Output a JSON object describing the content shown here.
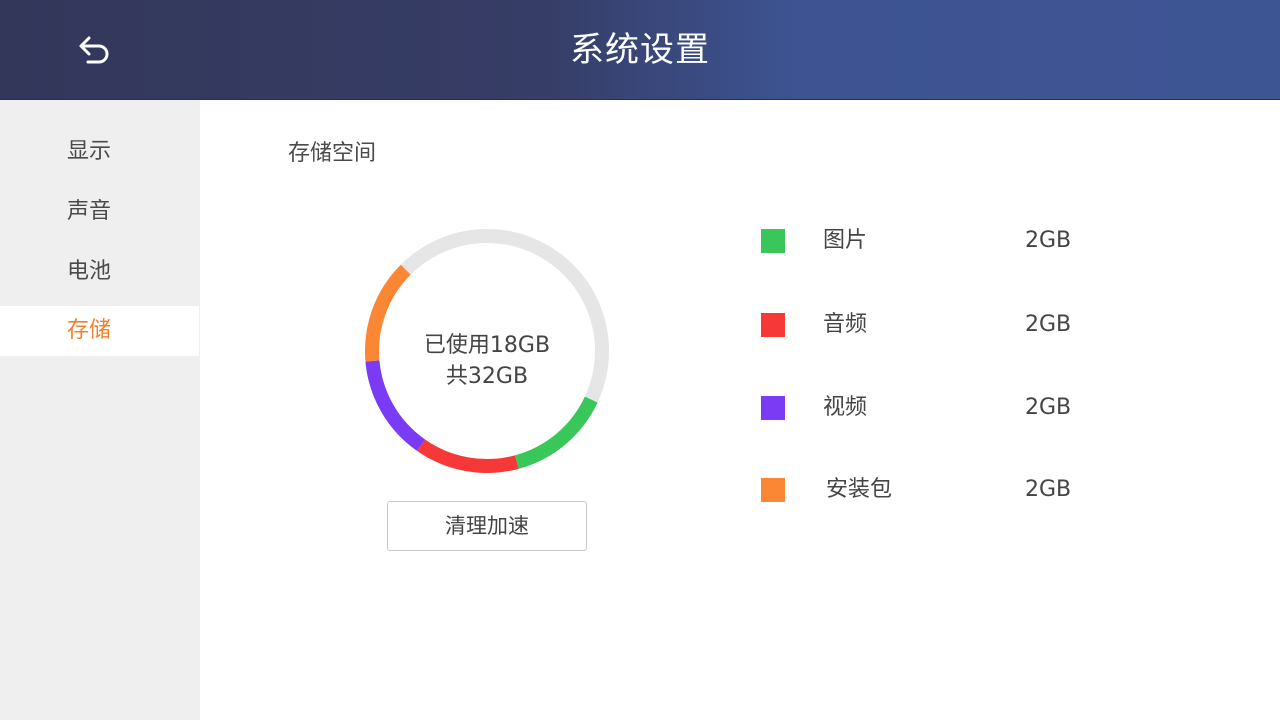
{
  "header": {
    "title": "系统设置",
    "back_icon": "back-arrow-icon"
  },
  "sidebar": {
    "items": [
      {
        "label": "显示",
        "active": false
      },
      {
        "label": "声音",
        "active": false
      },
      {
        "label": "电池",
        "active": false
      },
      {
        "label": "存储",
        "active": true
      }
    ]
  },
  "storage": {
    "section_title": "存储空间",
    "used_text": "已使用18GB",
    "total_text": "共32GB",
    "clean_button": "清理加速",
    "track_color": "#e6e6e6",
    "categories": [
      {
        "label": "图片",
        "value": "2GB",
        "color": "#39c75a"
      },
      {
        "label": "音频",
        "value": "2GB",
        "color": "#f73838"
      },
      {
        "label": "视频",
        "value": "2GB",
        "color": "#7b3bf5"
      },
      {
        "label": "安装包",
        "value": "2GB",
        "color": "#fb8634"
      }
    ]
  },
  "colors": {
    "accent": "#f47f2b",
    "header_start": "#33375a",
    "header_end": "#3e5594"
  }
}
